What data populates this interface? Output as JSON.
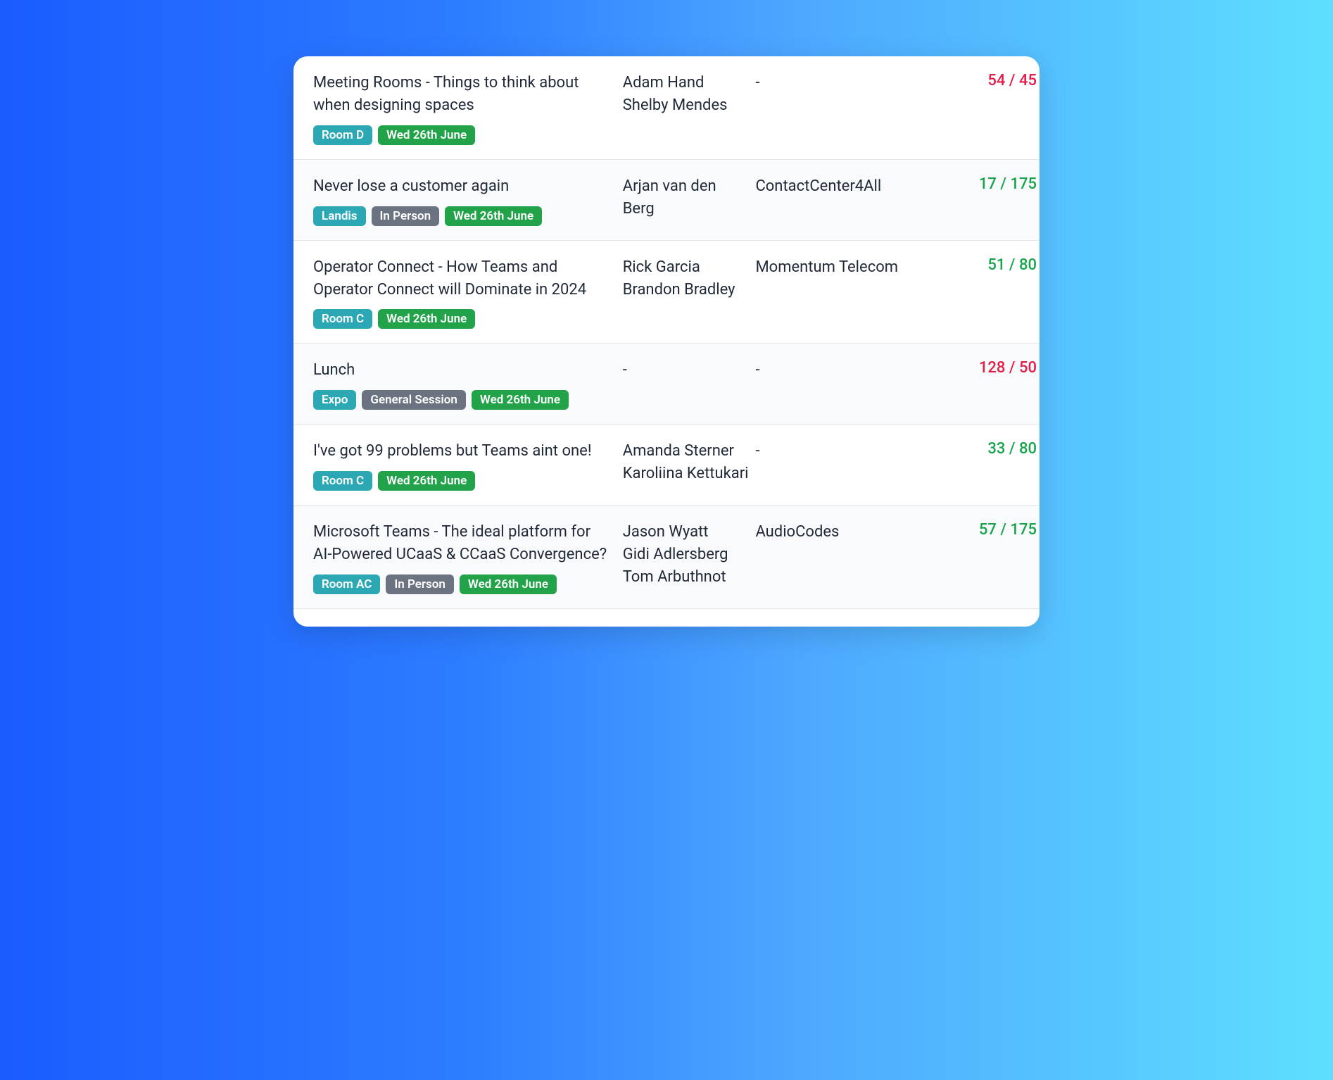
{
  "sessions": [
    {
      "title": "Meeting Rooms - Things to think about when designing spaces",
      "badges": [
        {
          "label": "Room D",
          "type": "teal"
        },
        {
          "label": "Wed 26th June",
          "type": "green"
        }
      ],
      "speakers": [
        "Adam Hand",
        "Shelby Mendes"
      ],
      "company": "-",
      "capacity": "54 / 45",
      "over": true
    },
    {
      "title": "Never lose a customer again",
      "badges": [
        {
          "label": "Landis",
          "type": "teal"
        },
        {
          "label": "In Person",
          "type": "gray"
        },
        {
          "label": "Wed 26th June",
          "type": "green"
        }
      ],
      "speakers": [
        "Arjan van den Berg"
      ],
      "company": "ContactCenter4All",
      "capacity": "17 / 175",
      "over": false
    },
    {
      "title": "Operator Connect - How Teams and Operator Connect will Dominate in 2024",
      "badges": [
        {
          "label": "Room C",
          "type": "teal"
        },
        {
          "label": "Wed 26th June",
          "type": "green"
        }
      ],
      "speakers": [
        "Rick Garcia",
        "Brandon Bradley"
      ],
      "company": "Momentum Telecom",
      "capacity": "51 / 80",
      "over": false
    },
    {
      "title": "Lunch",
      "badges": [
        {
          "label": "Expo",
          "type": "teal"
        },
        {
          "label": "General Session",
          "type": "gray"
        },
        {
          "label": "Wed 26th June",
          "type": "green"
        }
      ],
      "speakers": [
        "-"
      ],
      "company": "-",
      "capacity": "128 / 50",
      "over": true
    },
    {
      "title": "I've got 99 problems but Teams aint one!",
      "badges": [
        {
          "label": "Room C",
          "type": "teal"
        },
        {
          "label": "Wed 26th June",
          "type": "green"
        }
      ],
      "speakers": [
        "Amanda Sterner",
        "Karoliina Kettukari"
      ],
      "company": "-",
      "capacity": "33 / 80",
      "over": false
    },
    {
      "title": "Microsoft Teams - The ideal platform for AI-Powered UCaaS & CCaaS Convergence?",
      "badges": [
        {
          "label": "Room AC",
          "type": "teal"
        },
        {
          "label": "In Person",
          "type": "gray"
        },
        {
          "label": "Wed 26th June",
          "type": "green"
        }
      ],
      "speakers": [
        "Jason Wyatt",
        "Gidi Adlersberg",
        "Tom Arbuthnot"
      ],
      "company": "AudioCodes",
      "capacity": "57 / 175",
      "over": false
    }
  ]
}
